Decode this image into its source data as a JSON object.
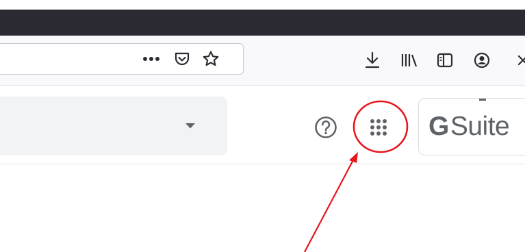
{
  "browser_toolbar": {
    "urlbar_menu_icon": "more-horizontal-icon",
    "urlbar_pocket_icon": "pocket-icon",
    "urlbar_bookmark_icon": "star-icon",
    "download_icon": "download-icon",
    "library_icon": "library-icon",
    "sidebar_icon": "sidebar-icon",
    "account_icon": "account-icon",
    "overflow_icon": "close-icon"
  },
  "app_header": {
    "search_dropdown_icon": "caret-down-icon",
    "help_icon": "help-icon",
    "apps_icon": "apps-grid-icon",
    "brand": {
      "g_letter": "G",
      "suite_text": "Suite"
    }
  },
  "annotation": {
    "highlight_color": "#e8141c",
    "arrow_color": "#e8141c"
  },
  "colors": {
    "titlebar": "#2b2a33",
    "toolbar": "#f9f9fb",
    "search_box": "#f1f3f4",
    "icon": "#5f6368"
  }
}
